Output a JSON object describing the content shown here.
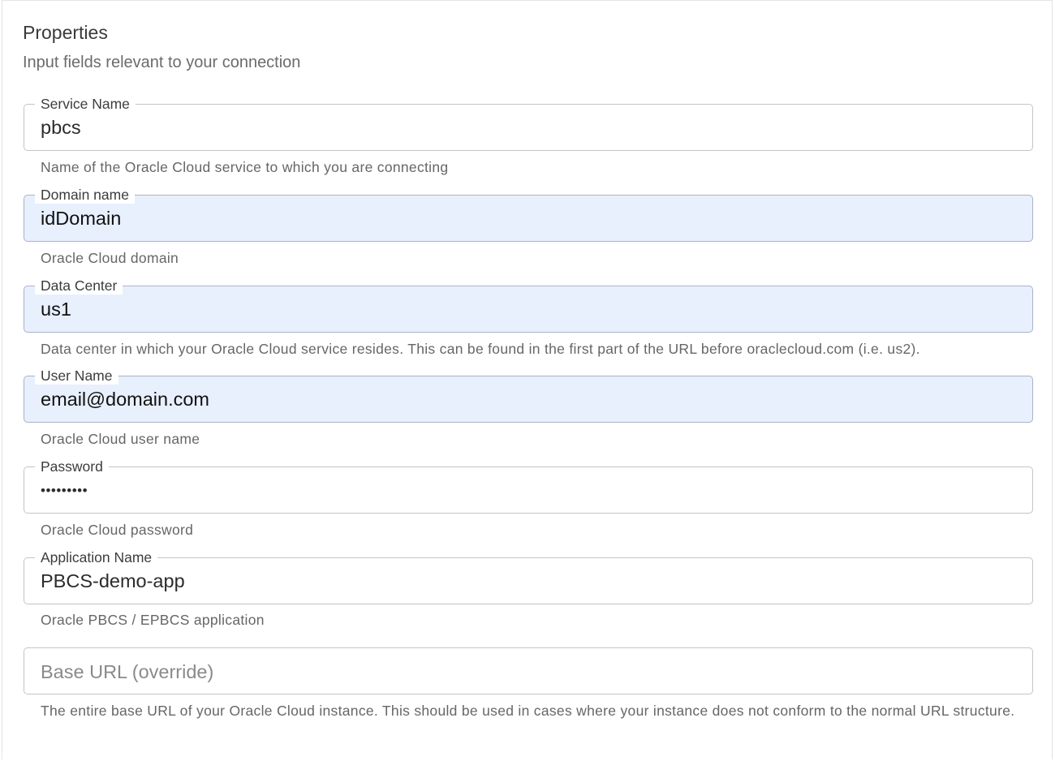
{
  "header": {
    "title": "Properties",
    "subtitle": "Input fields relevant to your connection"
  },
  "fields": [
    {
      "label": "Service Name",
      "value": "pbcs",
      "helper": "Name of the Oracle Cloud service to which you are connecting",
      "autofilled": false
    },
    {
      "label": "Domain name",
      "value": "idDomain",
      "helper": "Oracle Cloud domain",
      "autofilled": true
    },
    {
      "label": "Data Center",
      "value": "us1",
      "helper": "Data center in which your Oracle Cloud service resides. This can be found in the first part of the URL before oraclecloud.com (i.e. us2).",
      "autofilled": true
    },
    {
      "label": "User Name",
      "value": "email@domain.com",
      "helper": "Oracle Cloud user name",
      "autofilled": true
    },
    {
      "label": "Password",
      "value": "•••••••••",
      "helper": "Oracle Cloud password",
      "autofilled": false
    },
    {
      "label": "Application Name",
      "value": "PBCS-demo-app",
      "helper": "Oracle PBCS / EPBCS application",
      "autofilled": false
    },
    {
      "label": "",
      "value": "",
      "placeholder": "Base URL (override)",
      "helper": "The entire base URL of your Oracle Cloud instance. This should be used in cases where your instance does not conform to the normal URL structure.",
      "autofilled": false
    }
  ],
  "colors": {
    "autofill_background": "#e8f0fe",
    "border": "#c4c4c4",
    "helper_text": "#666666"
  }
}
